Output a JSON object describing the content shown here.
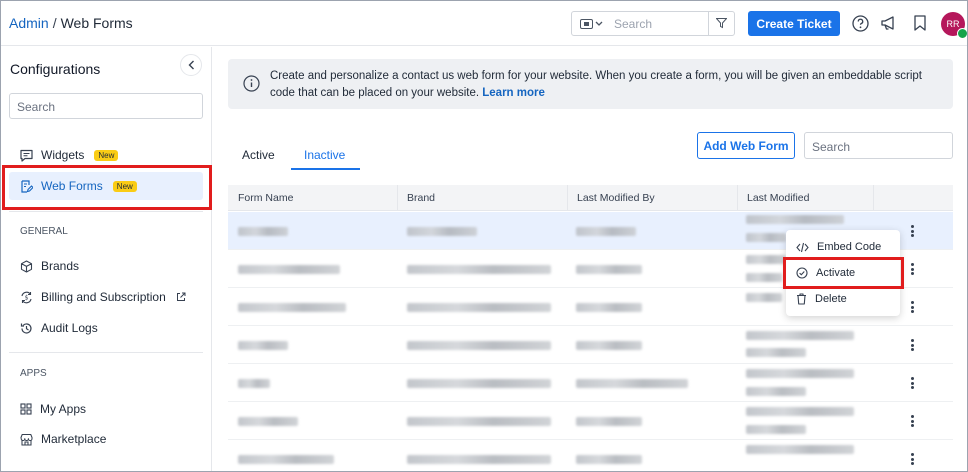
{
  "header": {
    "crumb_root": "Admin",
    "crumb_sep": "/",
    "crumb_current": "Web Forms",
    "search_placeholder": "Search",
    "create_ticket_label": "Create Ticket",
    "avatar_initials": "RR"
  },
  "sidebar": {
    "title": "Configurations",
    "search_placeholder": "Search",
    "items": [
      {
        "label": "Widgets",
        "badge": "New",
        "icon": "chat-widget-icon"
      },
      {
        "label": "Web Forms",
        "badge": "New",
        "icon": "form-edit-icon",
        "active": true
      }
    ],
    "general_heading": "GENERAL",
    "general_items": [
      {
        "label": "Brands",
        "icon": "cube-icon"
      },
      {
        "label": "Billing and Subscription",
        "icon": "dollar-cycle-icon",
        "external": true
      },
      {
        "label": "Audit Logs",
        "icon": "history-icon"
      }
    ],
    "apps_heading": "APPS",
    "apps_items": [
      {
        "label": "My Apps",
        "icon": "grid-icon"
      },
      {
        "label": "Marketplace",
        "icon": "store-icon"
      }
    ]
  },
  "info": {
    "text": "Create and personalize a contact us web form for your website. When you create a form, you will be given an embeddable script code that can be placed on your website.",
    "link": "Learn more"
  },
  "tabs": [
    {
      "label": "Active",
      "selected": false
    },
    {
      "label": "Inactive",
      "selected": true
    }
  ],
  "toolbar": {
    "add_label": "Add Web Form",
    "search_placeholder": "Search"
  },
  "table": {
    "columns": [
      "Form Name",
      "Brand",
      "Last Modified By",
      "Last Modified"
    ],
    "row_count": 7,
    "selected_row": 0,
    "content_obscured": true
  },
  "context_menu": {
    "items": [
      "Embed Code",
      "Activate",
      "Delete"
    ],
    "highlighted": "Activate"
  },
  "colors": {
    "accent": "#1a73e8",
    "highlight": "#e11d1d",
    "new_badge": "#facc15",
    "avatar": "#b5175b"
  }
}
